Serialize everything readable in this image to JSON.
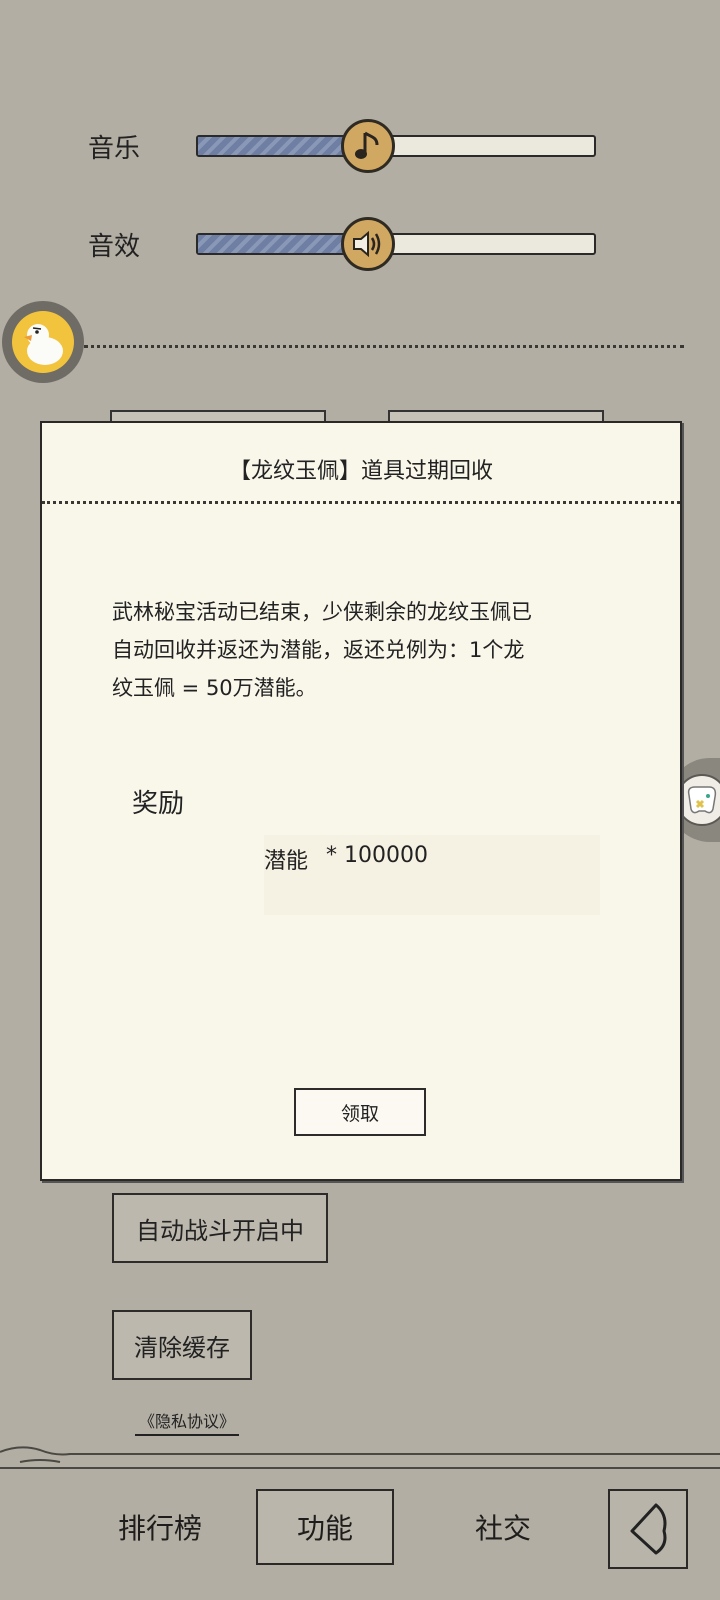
{
  "settings": {
    "music_label": "音乐",
    "music_level": 0.43,
    "sfx_label": "音效",
    "sfx_level": 0.43
  },
  "modal": {
    "title": "【龙纹玉佩】道具过期回收",
    "body_line1": "武林秘宝活动已结束，少侠剩余的龙纹玉佩已",
    "body_line2": "自动回收并返还为潜能，返还兑例为：1个龙",
    "body_line3": "纹玉佩 = 50万潜能。",
    "reward_heading": "奖励",
    "reward_name": "潜能",
    "reward_amount": "* 100000",
    "claim_label": "领取"
  },
  "side_buttons": {
    "auto_battle": "自动战斗开启中",
    "clear_cache": "清除缓存",
    "privacy": "《隐私协议》"
  },
  "bottom_nav": {
    "ranking": "排行榜",
    "function": "功能",
    "social": "社交"
  },
  "colors": {
    "background": "#b2aea3",
    "modal_bg": "#f9f6ea",
    "knob": "#d1a862",
    "slider_fill": "#7a89ab",
    "avatar_duck": "#f2c33d"
  }
}
